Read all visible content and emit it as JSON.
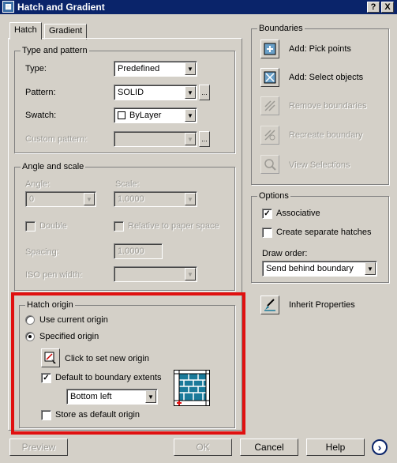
{
  "window": {
    "title": "Hatch and Gradient",
    "help_glyph": "?",
    "close_glyph": "X"
  },
  "tabs": [
    {
      "label": "Hatch"
    },
    {
      "label": "Gradient"
    }
  ],
  "type_pattern": {
    "group_label": "Type and pattern",
    "type_label": "Type:",
    "type_value": "Predefined",
    "pattern_label": "Pattern:",
    "pattern_value": "SOLID",
    "swatch_label": "Swatch:",
    "swatch_value": "ByLayer",
    "custom_label": "Custom pattern:",
    "custom_value": "",
    "more_glyph": "..."
  },
  "angle_scale": {
    "group_label": "Angle and scale",
    "angle_label": "Angle:",
    "angle_value": "0",
    "scale_label": "Scale:",
    "scale_value": "1.0000",
    "double_label": "Double",
    "relative_label": "Relative to paper space",
    "spacing_label": "Spacing:",
    "spacing_value": "1.0000",
    "iso_label": "ISO pen width:",
    "iso_value": ""
  },
  "hatch_origin": {
    "group_label": "Hatch origin",
    "use_current_label": "Use current origin",
    "specified_label": "Specified origin",
    "click_set_label": "Click to set new origin",
    "default_extents_label": "Default to boundary extents",
    "position_value": "Bottom left",
    "store_default_label": "Store as default origin"
  },
  "boundaries": {
    "group_label": "Boundaries",
    "items": [
      {
        "label": "Add: Pick points"
      },
      {
        "label": "Add: Select objects"
      },
      {
        "label": "Remove boundaries"
      },
      {
        "label": "Recreate boundary"
      },
      {
        "label": "View Selections"
      }
    ]
  },
  "options": {
    "group_label": "Options",
    "associative_label": "Associative",
    "separate_label": "Create separate hatches",
    "draw_order_label": "Draw order:",
    "draw_order_value": "Send behind boundary"
  },
  "inherit_label": "Inherit Properties",
  "buttons": {
    "preview": "Preview",
    "ok": "OK",
    "cancel": "Cancel",
    "help": "Help",
    "more": "›"
  },
  "colors": {
    "title_bar": "#0a246a",
    "face": "#d4d0c8",
    "highlight_box": "#e01010"
  }
}
